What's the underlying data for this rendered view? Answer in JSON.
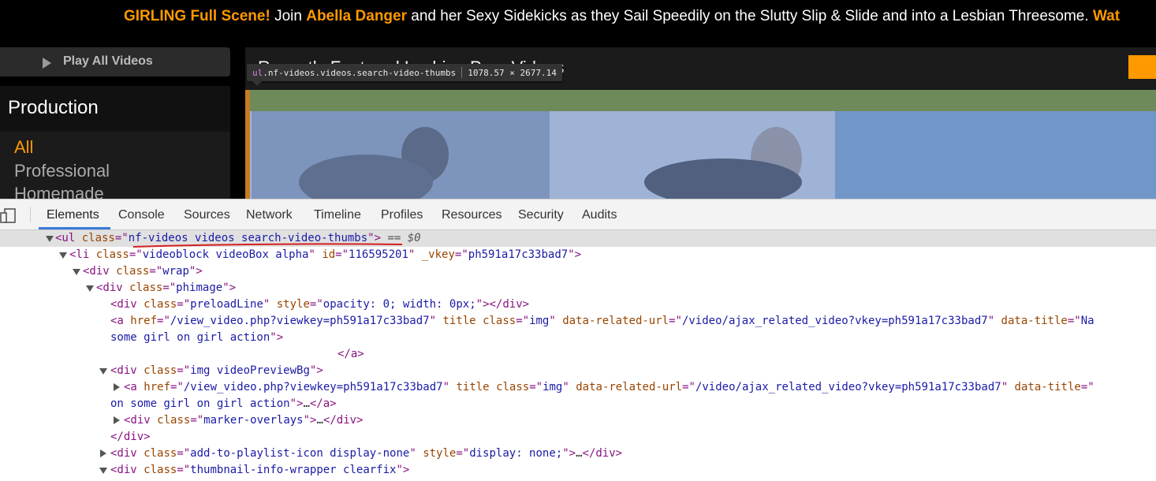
{
  "banner": {
    "part1": "GIRLING Full Scene!",
    "part2": " Join ",
    "part3": "Abella Danger",
    "part4": " and her Sexy Sidekicks as they Sail Speedily on the Slutty Slip & Slide and into a Lesbian Threesome. ",
    "part5": "Wat"
  },
  "sidebar": {
    "play_all_label": "Play All Videos",
    "filter_title": "Production",
    "filter_options": [
      "All",
      "Professional",
      "Homemade"
    ]
  },
  "main": {
    "section_title": "Recently Featured Lesbian Porn Videos"
  },
  "tooltip": {
    "tag": "ul",
    "selector": ".nf-videos.videos.search-video-thumbs",
    "dimensions": "1078.57 × 2677.14"
  },
  "devtools": {
    "tabs": [
      "Elements",
      "Console",
      "Sources",
      "Network",
      "Timeline",
      "Profiles",
      "Resources",
      "Security",
      "Audits"
    ],
    "active_tab": "Elements",
    "selected_suffix": "== $0",
    "lines": [
      {
        "parts": [
          [
            "tag",
            "<ul "
          ],
          [
            "an",
            "class"
          ],
          [
            "tag",
            "=\""
          ],
          [
            "av",
            "nf-videos videos search-video-thumbs"
          ],
          [
            "tag",
            "\">"
          ]
        ]
      },
      {
        "parts": [
          [
            "tag",
            "<li "
          ],
          [
            "an",
            "class"
          ],
          [
            "tag",
            "=\""
          ],
          [
            "av",
            "videoblock videoBox alpha"
          ],
          [
            "tag",
            "\" "
          ],
          [
            "an",
            "id"
          ],
          [
            "tag",
            "=\""
          ],
          [
            "av",
            "116595201"
          ],
          [
            "tag",
            "\" "
          ],
          [
            "an",
            "_vkey"
          ],
          [
            "tag",
            "=\""
          ],
          [
            "av",
            "ph591a17c33bad7"
          ],
          [
            "tag",
            "\">"
          ]
        ]
      },
      {
        "parts": [
          [
            "tag",
            "<div "
          ],
          [
            "an",
            "class"
          ],
          [
            "tag",
            "=\""
          ],
          [
            "av",
            "wrap"
          ],
          [
            "tag",
            "\">"
          ]
        ]
      },
      {
        "parts": [
          [
            "tag",
            "<div "
          ],
          [
            "an",
            "class"
          ],
          [
            "tag",
            "=\""
          ],
          [
            "av",
            "phimage"
          ],
          [
            "tag",
            "\">"
          ]
        ]
      },
      {
        "parts": [
          [
            "tag",
            "<div "
          ],
          [
            "an",
            "class"
          ],
          [
            "tag",
            "=\""
          ],
          [
            "av",
            "preloadLine"
          ],
          [
            "tag",
            "\" "
          ],
          [
            "an",
            "style"
          ],
          [
            "tag",
            "=\""
          ],
          [
            "av",
            "opacity: 0; width: 0px;"
          ],
          [
            "tag",
            "\"></div>"
          ]
        ]
      },
      {
        "parts": [
          [
            "tag",
            "<a "
          ],
          [
            "an",
            "href"
          ],
          [
            "tag",
            "=\""
          ],
          [
            "av",
            "/view_video.php?viewkey=ph591a17c33bad7"
          ],
          [
            "tag",
            "\" "
          ],
          [
            "an",
            "title"
          ],
          [
            "tag",
            " "
          ],
          [
            "an",
            "class"
          ],
          [
            "tag",
            "=\""
          ],
          [
            "av",
            "img"
          ],
          [
            "tag",
            "\" "
          ],
          [
            "an",
            "data-related-url"
          ],
          [
            "tag",
            "=\""
          ],
          [
            "av",
            "/video/ajax_related_video?vkey=ph591a17c33bad7"
          ],
          [
            "tag",
            "\" "
          ],
          [
            "an",
            "data-title"
          ],
          [
            "tag",
            "=\""
          ],
          [
            "av",
            "Na"
          ]
        ]
      },
      {
        "parts": [
          [
            "av",
            "some girl on girl action"
          ],
          [
            "tag",
            "\">"
          ]
        ]
      },
      {
        "parts": [
          [
            "tag",
            "</a>"
          ]
        ]
      },
      {
        "parts": [
          [
            "tag",
            "<div "
          ],
          [
            "an",
            "class"
          ],
          [
            "tag",
            "=\""
          ],
          [
            "av",
            "img videoPreviewBg"
          ],
          [
            "tag",
            "\">"
          ]
        ]
      },
      {
        "parts": [
          [
            "tag",
            "<a "
          ],
          [
            "an",
            "href"
          ],
          [
            "tag",
            "=\""
          ],
          [
            "av",
            "/view_video.php?viewkey=ph591a17c33bad7"
          ],
          [
            "tag",
            "\" "
          ],
          [
            "an",
            "title"
          ],
          [
            "tag",
            " "
          ],
          [
            "an",
            "class"
          ],
          [
            "tag",
            "=\""
          ],
          [
            "av",
            "img"
          ],
          [
            "tag",
            "\" "
          ],
          [
            "an",
            "data-related-url"
          ],
          [
            "tag",
            "=\""
          ],
          [
            "av",
            "/video/ajax_related_video?vkey=ph591a17c33bad7"
          ],
          [
            "tag",
            "\" "
          ],
          [
            "an",
            "data-title"
          ],
          [
            "tag",
            "=\""
          ]
        ]
      },
      {
        "parts": [
          [
            "av",
            "on some girl on girl action"
          ],
          [
            "tag",
            "\">"
          ],
          [
            "tx",
            "…"
          ],
          [
            "tag",
            "</a>"
          ]
        ]
      },
      {
        "parts": [
          [
            "tag",
            "<div "
          ],
          [
            "an",
            "class"
          ],
          [
            "tag",
            "=\""
          ],
          [
            "av",
            "marker-overlays"
          ],
          [
            "tag",
            "\">"
          ],
          [
            "tx",
            "…"
          ],
          [
            "tag",
            "</div>"
          ]
        ]
      },
      {
        "parts": [
          [
            "tag",
            "</div>"
          ]
        ]
      },
      {
        "parts": [
          [
            "tag",
            "<div "
          ],
          [
            "an",
            "class"
          ],
          [
            "tag",
            "=\""
          ],
          [
            "av",
            "add-to-playlist-icon display-none"
          ],
          [
            "tag",
            "\" "
          ],
          [
            "an",
            "style"
          ],
          [
            "tag",
            "=\""
          ],
          [
            "av",
            "display: none;"
          ],
          [
            "tag",
            "\">"
          ],
          [
            "tx",
            "…"
          ],
          [
            "tag",
            "</div>"
          ]
        ]
      },
      {
        "parts": [
          [
            "tag",
            "<div "
          ],
          [
            "an",
            "class"
          ],
          [
            "tag",
            "=\""
          ],
          [
            "av",
            "thumbnail-info-wrapper clearfix"
          ],
          [
            "tag",
            "\">"
          ]
        ]
      }
    ]
  }
}
